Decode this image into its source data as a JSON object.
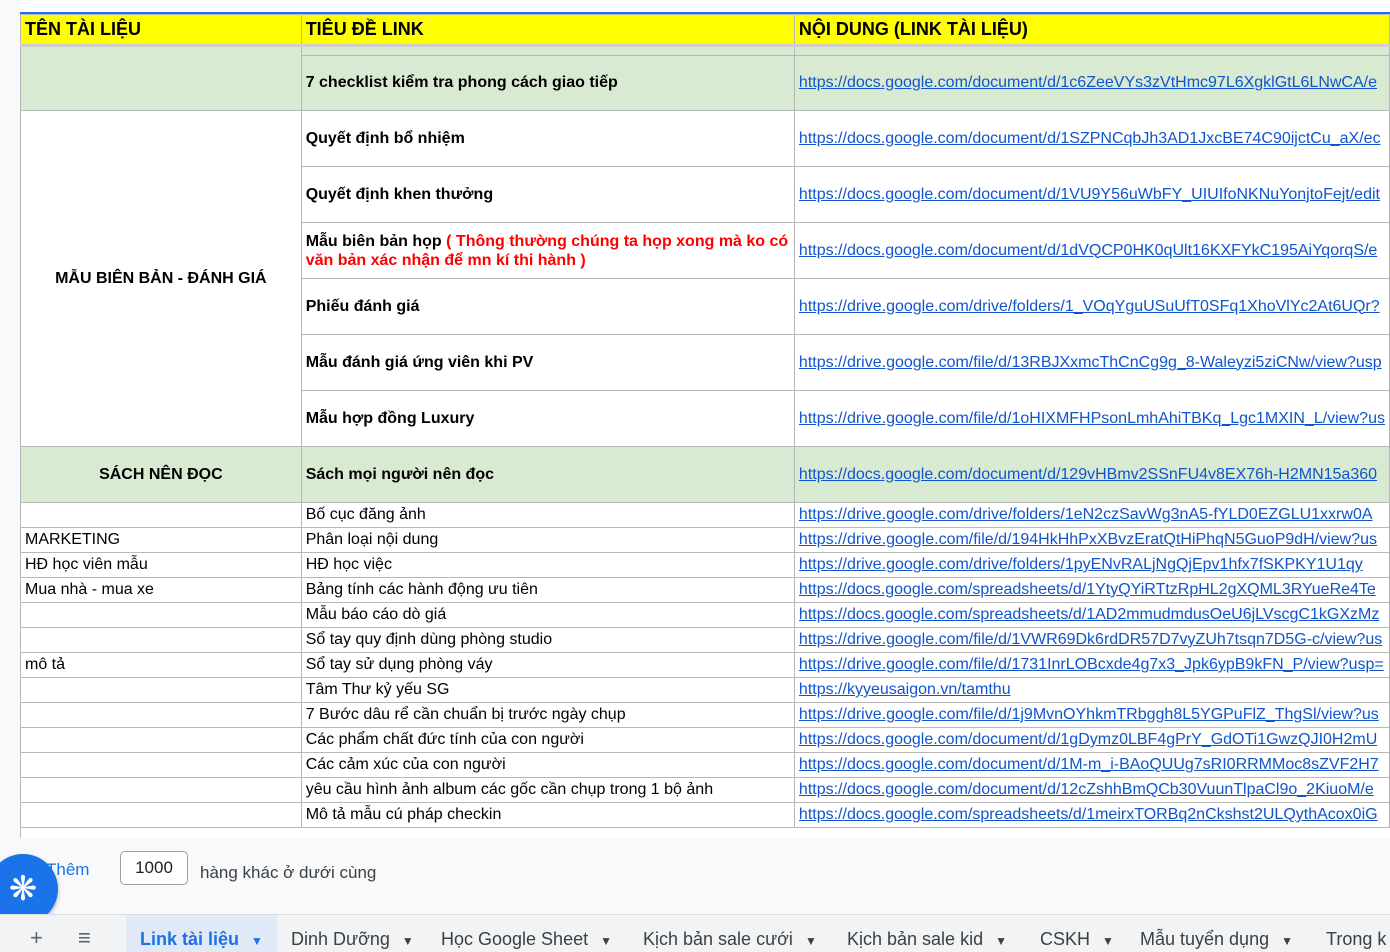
{
  "header": {
    "col1": "TÊN TÀI LIỆU",
    "col2": "TIÊU ĐỀ LINK",
    "col3": "NỘI DUNG (LINK TÀI LIỆU)"
  },
  "groups": {
    "bien_ban": "MẪU BIÊN BẢN - ĐÁNH GIÁ",
    "sach": "SÁCH NÊN ĐỌC"
  },
  "rows": [
    {
      "title": "7 checklist kiểm tra phong cách giao tiếp",
      "link": "https://docs.google.com/document/d/1c6ZeeVYs3zVtHmc97L6XgklGtL6LNwCA/e"
    },
    {
      "title": "Quyết định bổ nhiệm",
      "link": "https://docs.google.com/document/d/1SZPNCqbJh3AD1JxcBE74C90ijctCu_aX/ec"
    },
    {
      "title": "Quyết định khen thưởng",
      "link": "https://docs.google.com/document/d/1VU9Y56uWbFY_UIUIfoNKNuYonjtoFejt/edit"
    },
    {
      "title": "Mẫu biên bản họp",
      "note": "( Thông thường chúng ta họp xong mà ko có văn bản xác nhận để mn kí thi hành )",
      "link": "https://docs.google.com/document/d/1dVQCP0HK0qUlt16KXFYkC195AiYqorqS/e"
    },
    {
      "title": "Phiếu đánh giá",
      "link": "https://drive.google.com/drive/folders/1_VOqYguUSuUfT0SFq1XhoVlYc2At6UQr?"
    },
    {
      "title": "Mẫu đánh giá ứng viên khi PV",
      "link": "https://drive.google.com/file/d/13RBJXxmcThCnCg9g_8-Waleyzi5ziCNw/view?usp"
    },
    {
      "title": "Mẫu hợp đồng Luxury",
      "link": "https://drive.google.com/file/d/1oHIXMFHPsonLmhAhiTBKq_Lgc1MXIN_L/view?us"
    },
    {
      "title": "Sách mọi người nên đọc",
      "link": "https://docs.google.com/document/d/129vHBmv2SSnFU4v8EX76h-H2MN15a360"
    }
  ],
  "small_rows": [
    {
      "name": "",
      "title": "Bố cục đăng ảnh",
      "link": "https://drive.google.com/drive/folders/1eN2czSavWg3nA5-fYLD0EZGLU1xxrw0A"
    },
    {
      "name": "MARKETING",
      "title": "Phân loại nội dung",
      "link": "https://drive.google.com/file/d/194HkHhPxXBvzEratQtHiPhqN5GuoP9dH/view?us"
    },
    {
      "name": "HĐ học viên mẫu",
      "title": "HĐ học việc",
      "link": "https://drive.google.com/drive/folders/1pyENvRALjNgQjEpv1hfx7fSKPKY1U1qy"
    },
    {
      "name": "Mua nhà - mua xe",
      "title": "Bảng tính các hành động ưu tiên",
      "link": "https://docs.google.com/spreadsheets/d/1YtyQYiRTtzRpHL2gXQML3RYueRe4Te"
    },
    {
      "name": "",
      "title": "Mẫu báo cáo dò giá",
      "link": "https://docs.google.com/spreadsheets/d/1AD2mmudmdusOeU6jLVscgC1kGXzMz"
    },
    {
      "name": "",
      "title": "Sổ tay quy định dùng phòng studio",
      "link": "https://drive.google.com/file/d/1VWR69Dk6rdDR57D7vyZUh7tsqn7D5G-c/view?us"
    },
    {
      "name": "mô tả",
      "title": "Sổ tay sử dụng phòng váy",
      "link": "https://drive.google.com/file/d/1731InrLOBcxde4g7x3_Jpk6ypB9kFN_P/view?usp="
    },
    {
      "name": "",
      "title": "Tâm Thư kỷ yếu SG",
      "link": "https://kyyeusaigon.vn/tamthu"
    },
    {
      "name": "",
      "title": "7 Bước dâu rể cần chuẩn bị trước ngày chụp",
      "link": "https://drive.google.com/file/d/1j9MvnOYhkmTRbggh8L5YGPuFlZ_ThgSl/view?us"
    },
    {
      "name": "",
      "title": "Các phẩm chất đức tính của con người",
      "link": "https://docs.google.com/document/d/1gDymz0LBF4gPrY_GdOTi1GwzQJI0H2mU"
    },
    {
      "name": "",
      "title": "Các cảm xúc của con người",
      "link": "https://docs.google.com/document/d/1M-m_i-BAoQUUg7sRI0RRMMoc8sZVF2H7"
    },
    {
      "name": "",
      "title": "yêu cầu hình ảnh album các gốc cần chụp trong 1 bộ ảnh",
      "link": "https://docs.google.com/document/d/12cZshhBmQCb30VuunTlpaCl9o_2KiuoM/e"
    },
    {
      "name": "",
      "title": "Mô tả mẫu cú pháp checkin",
      "link": "https://docs.google.com/spreadsheets/d/1meirxTORBq2nCkshst2ULQythAcox0iG"
    }
  ],
  "footer": {
    "more_label": "Thêm",
    "rows_value": "1000",
    "rows_suffix": "hàng khác ở dưới cùng"
  },
  "fab_icon": "snowflake-icon",
  "tabs": [
    {
      "label": "Link tài liệu",
      "active": true
    },
    {
      "label": "Dinh Dưỡng"
    },
    {
      "label": "Học Google Sheet"
    },
    {
      "label": "Kịch bản sale cưới"
    },
    {
      "label": "Kịch bản sale kid"
    },
    {
      "label": "CSKH"
    },
    {
      "label": "Mẫu tuyển dụng"
    },
    {
      "label": "Trong k"
    }
  ],
  "colors": {
    "header_bg": "#ffff00",
    "group_bg": "#d9ead3",
    "link": "#1155cc",
    "note_red": "#ff0000",
    "accent": "#1a73e8"
  }
}
